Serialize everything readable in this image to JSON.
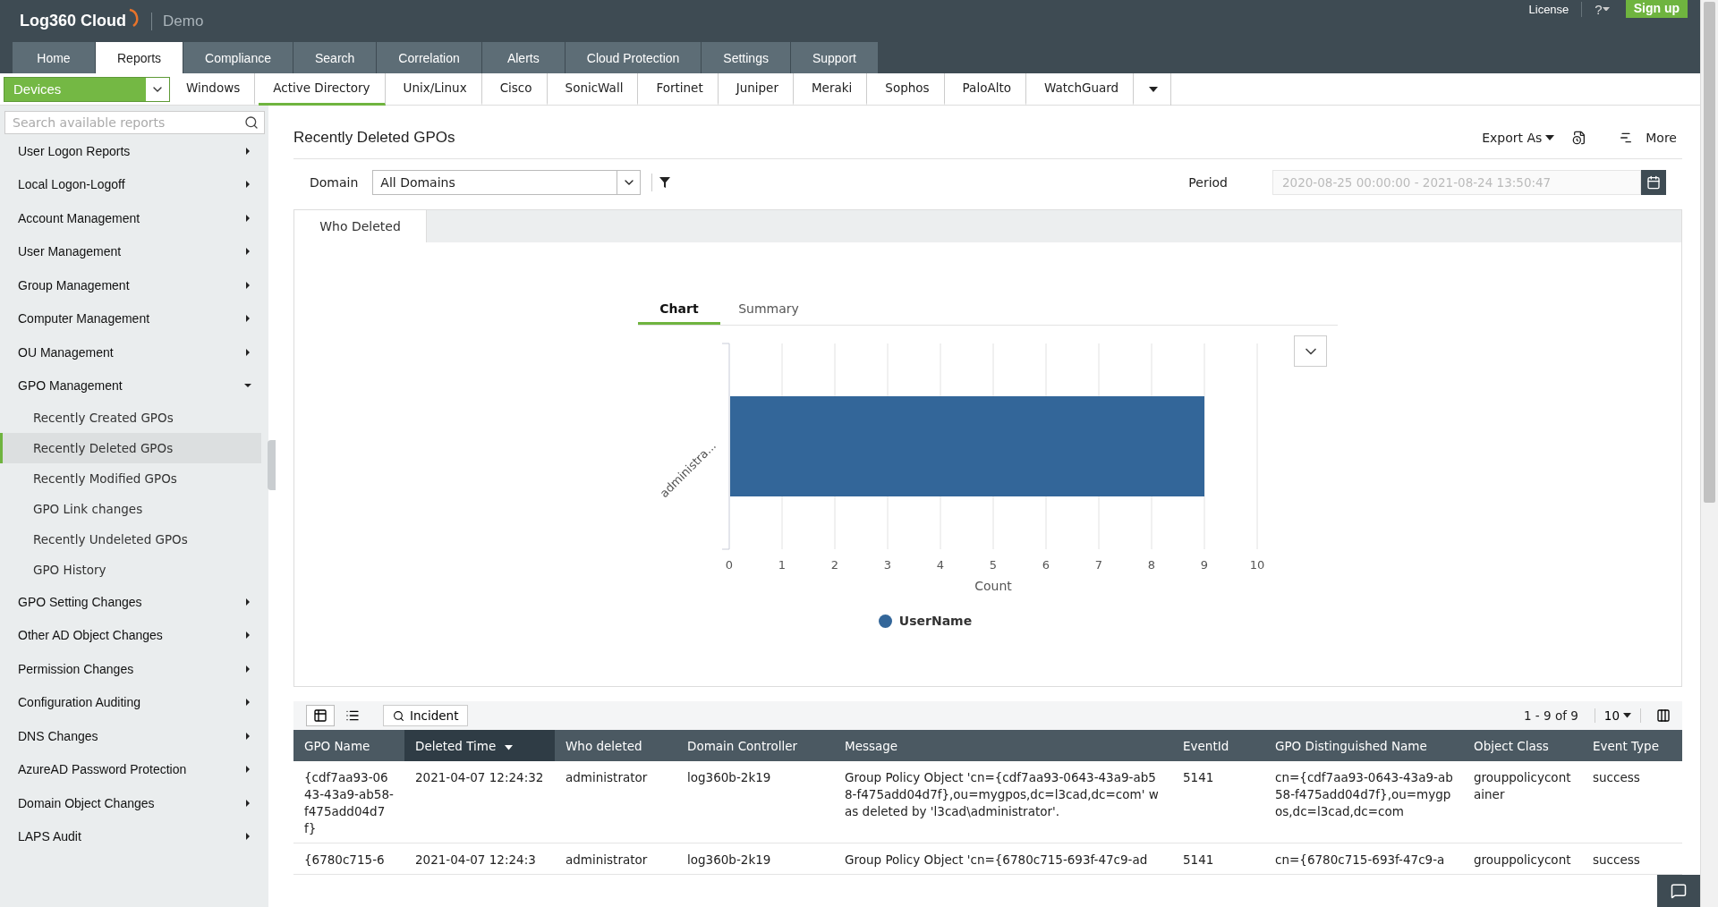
{
  "header": {
    "logo": "Log360 Cloud",
    "edition": "Demo",
    "license": "License",
    "help": "?",
    "signup": "Sign up"
  },
  "top_tabs": [
    {
      "label": "Home",
      "selected": false
    },
    {
      "label": "Reports",
      "selected": true
    },
    {
      "label": "Compliance",
      "selected": false
    },
    {
      "label": "Search",
      "selected": false
    },
    {
      "label": "Correlation",
      "selected": false
    },
    {
      "label": "Alerts",
      "selected": false
    },
    {
      "label": "Cloud Protection",
      "selected": false
    },
    {
      "label": "Settings",
      "selected": false
    },
    {
      "label": "Support",
      "selected": false
    }
  ],
  "device_select": "Devices",
  "sub_tabs": [
    {
      "label": "Windows",
      "selected": false
    },
    {
      "label": "Active Directory",
      "selected": true
    },
    {
      "label": "Unix/Linux",
      "selected": false
    },
    {
      "label": "Cisco",
      "selected": false
    },
    {
      "label": "SonicWall",
      "selected": false
    },
    {
      "label": "Fortinet",
      "selected": false
    },
    {
      "label": "Juniper",
      "selected": false
    },
    {
      "label": "Meraki",
      "selected": false
    },
    {
      "label": "Sophos",
      "selected": false
    },
    {
      "label": "PaloAlto",
      "selected": false
    },
    {
      "label": "WatchGuard",
      "selected": false
    }
  ],
  "sidebar": {
    "search": {
      "placeholder": "Search available reports"
    },
    "items": [
      {
        "label": "User Logon Reports",
        "expanded": false
      },
      {
        "label": "Local Logon-Logoff",
        "expanded": false
      },
      {
        "label": "Account Management",
        "expanded": false
      },
      {
        "label": "User Management",
        "expanded": false
      },
      {
        "label": "Group Management",
        "expanded": false
      },
      {
        "label": "Computer Management",
        "expanded": false
      },
      {
        "label": "OU Management",
        "expanded": false
      },
      {
        "label": "GPO Management",
        "expanded": true,
        "children": [
          {
            "label": "Recently Created GPOs",
            "selected": false
          },
          {
            "label": "Recently Deleted GPOs",
            "selected": true
          },
          {
            "label": "Recently Modified GPOs",
            "selected": false
          },
          {
            "label": "GPO Link changes",
            "selected": false
          },
          {
            "label": "Recently Undeleted GPOs",
            "selected": false
          },
          {
            "label": "GPO History",
            "selected": false
          }
        ]
      },
      {
        "label": "GPO Setting Changes",
        "expanded": false
      },
      {
        "label": "Other AD Object Changes",
        "expanded": false
      },
      {
        "label": "Permission Changes",
        "expanded": false
      },
      {
        "label": "Configuration Auditing",
        "expanded": false
      },
      {
        "label": "DNS Changes",
        "expanded": false
      },
      {
        "label": "AzureAD Password Protection",
        "expanded": false
      },
      {
        "label": "Domain Object Changes",
        "expanded": false
      },
      {
        "label": "LAPS Audit",
        "expanded": false
      }
    ]
  },
  "report": {
    "title": "Recently Deleted GPOs",
    "export": "Export As",
    "more": "More",
    "domain": {
      "label": "Domain",
      "value": "All Domains"
    },
    "period": {
      "label": "Period",
      "value": "2020-08-25 00:00:00 - 2021-08-24 13:50:47"
    },
    "panel_tabs": [
      {
        "label": "Who Deleted",
        "selected": true
      }
    ],
    "chart_tabs": [
      {
        "label": "Chart",
        "selected": true
      },
      {
        "label": "Summary",
        "selected": false
      }
    ],
    "chart_data": {
      "type": "bar",
      "orientation": "horizontal",
      "xlabel": "Count",
      "categories": [
        "administra..."
      ],
      "series": [
        {
          "name": "UserName",
          "color": "#336699",
          "values": [
            9
          ]
        }
      ],
      "xlim": [
        0,
        10
      ],
      "grid": true,
      "xticks": [
        0,
        1,
        2,
        3,
        4,
        5,
        6,
        7,
        8,
        9,
        10
      ]
    }
  },
  "toolbar": {
    "views": [
      {
        "kind": "table",
        "selected": true
      },
      {
        "kind": "list",
        "selected": false
      }
    ],
    "incident": "Incident",
    "range": "1 - 9 of 9",
    "page_size": "10"
  },
  "table": {
    "columns": [
      {
        "label": "GPO Name",
        "sorted": false
      },
      {
        "label": "Deleted Time",
        "sorted": true
      },
      {
        "label": "Who deleted",
        "sorted": false
      },
      {
        "label": "Domain Controller",
        "sorted": false
      },
      {
        "label": "Message",
        "sorted": false
      },
      {
        "label": "EventId",
        "sorted": false
      },
      {
        "label": "GPO Distinguished Name",
        "sorted": false
      },
      {
        "label": "Object Class",
        "sorted": false
      },
      {
        "label": "Event Type",
        "sorted": false
      }
    ],
    "rows": [
      [
        "{cdf7aa93-0643-43a9-ab58-f475add04d7f}",
        "2021-04-07 12:24:32",
        "administrator",
        "log360b-2k19",
        "Group Policy Object 'cn={cdf7aa93-0643-43a9-ab58-f475add04d7f},ou=mygpos,dc=l3cad,dc=com' was deleted by 'l3cad\\administrator'.",
        "5141",
        "cn={cdf7aa93-0643-43a9-ab58-f475add04d7f},ou=mygpos,dc=l3cad,dc=com",
        "grouppolicycontainer",
        "success"
      ],
      [
        "{6780c715-6",
        "2021-04-07 12:24:3",
        "administrator",
        "log360b-2k19",
        "Group Policy Object 'cn={6780c715-693f-47c9-ad",
        "5141",
        "cn={6780c715-693f-47c9-a",
        "grouppolicycont",
        "success"
      ]
    ]
  }
}
